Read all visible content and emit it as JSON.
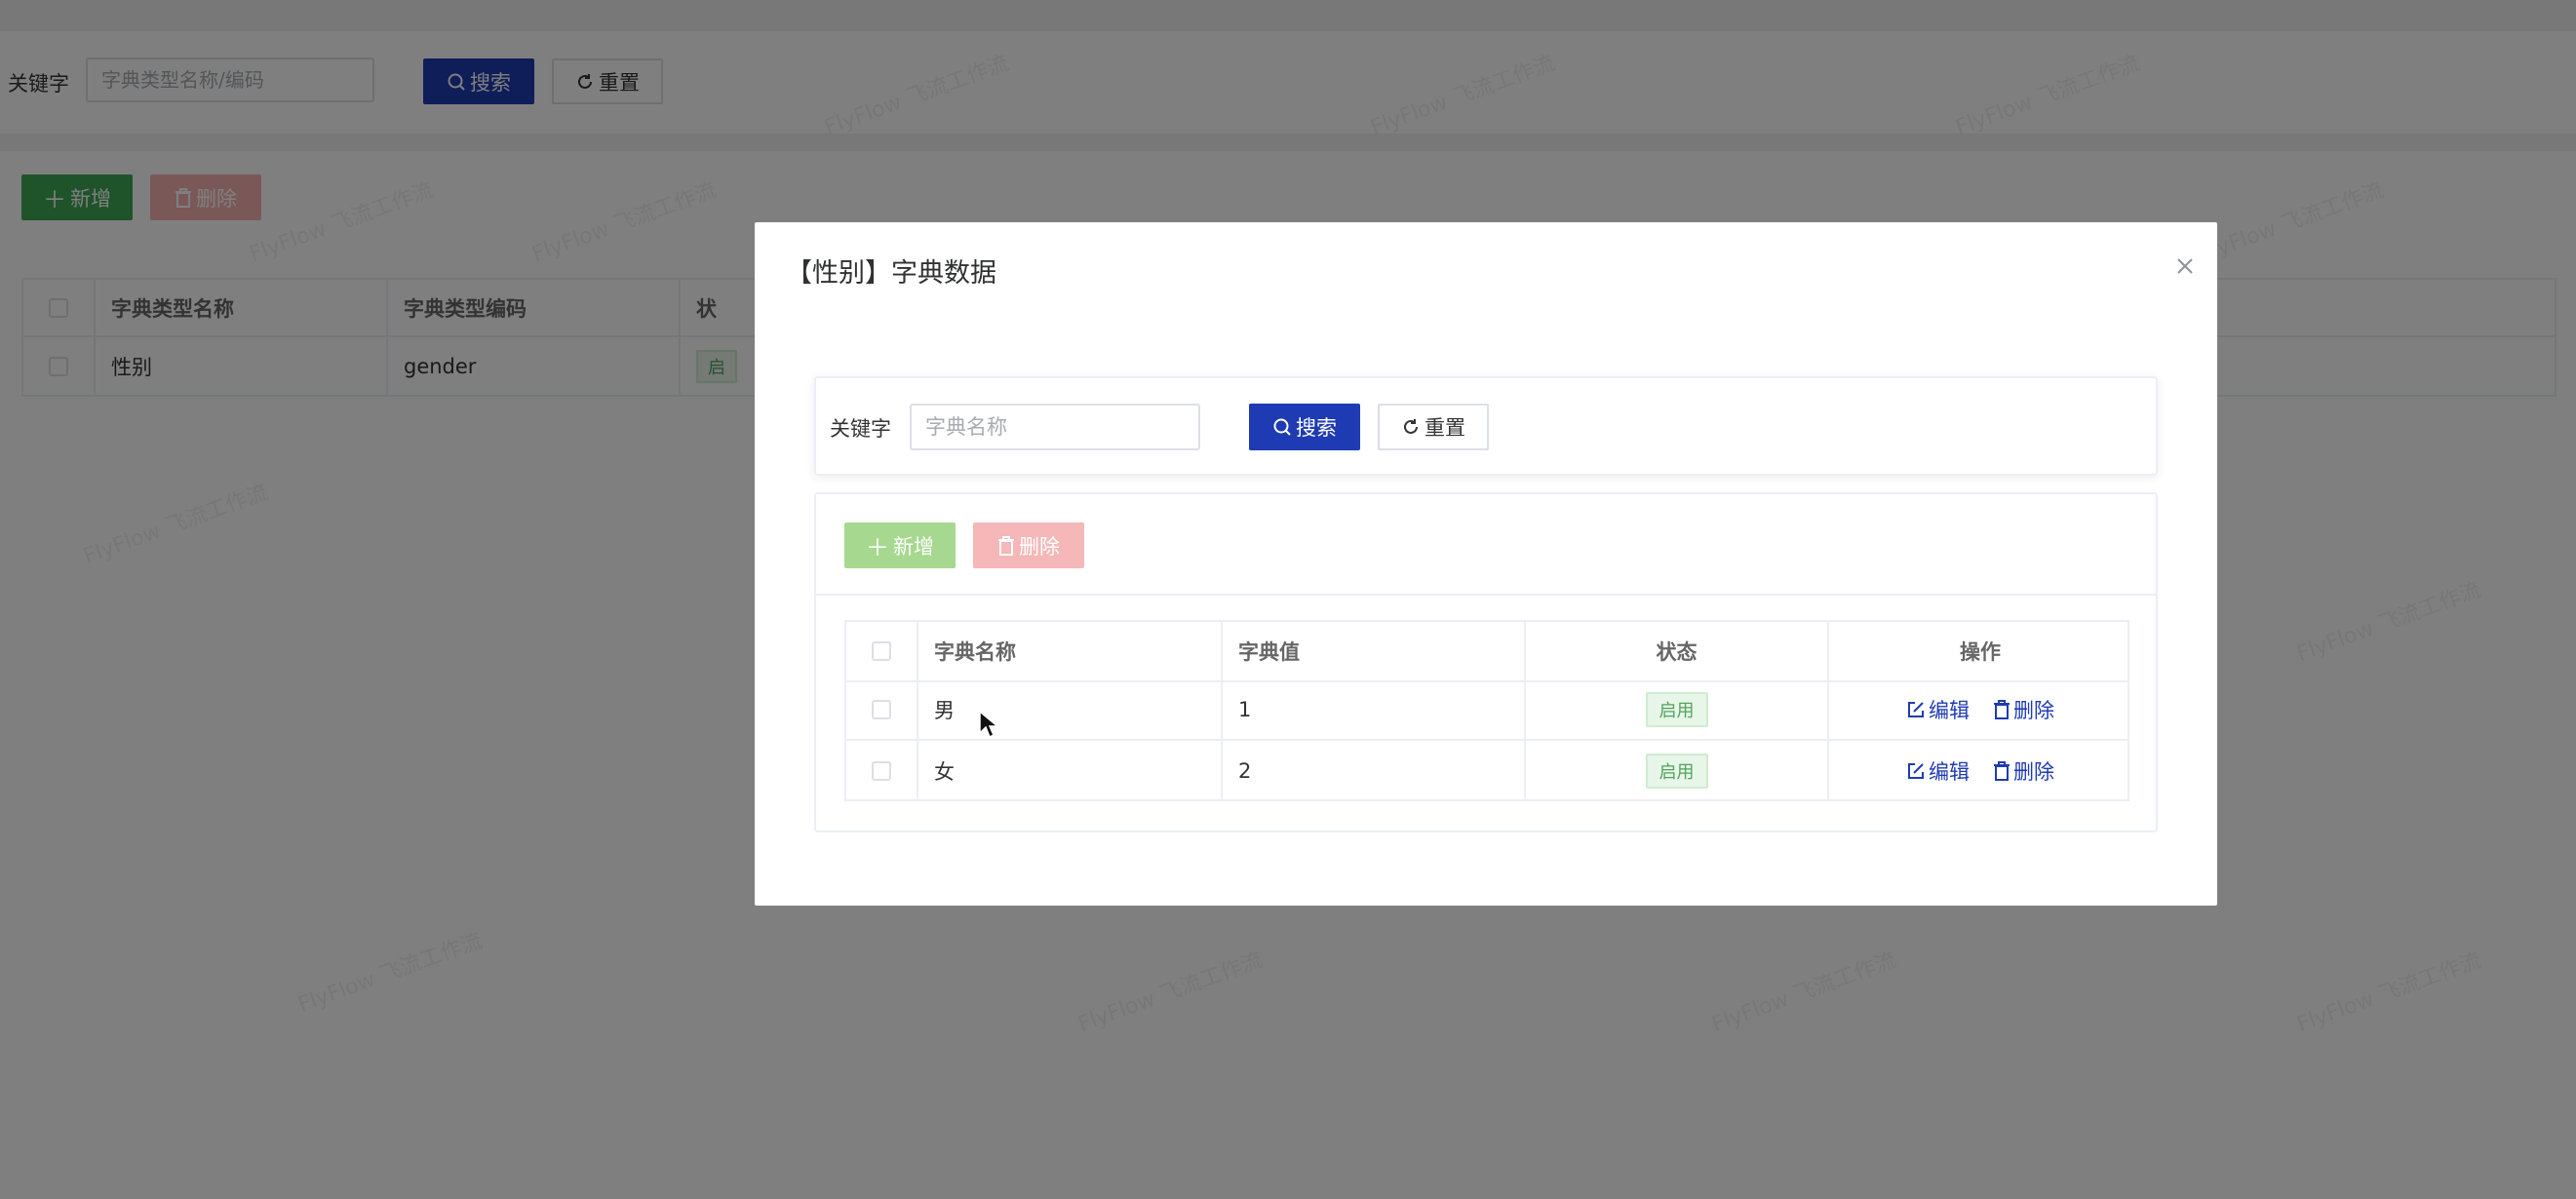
{
  "background": {
    "search": {
      "label": "关键字",
      "placeholder": "字典类型名称/编码",
      "search_label": "搜索",
      "reset_label": "重置"
    },
    "toolbar": {
      "add_label": "新增",
      "delete_label": "删除"
    },
    "table": {
      "headers": [
        "字典类型名称",
        "字典类型编码",
        "状"
      ],
      "rows": [
        {
          "name": "性别",
          "code": "gender",
          "status": "启"
        }
      ]
    },
    "watermark": "FlyFlow 飞流工作流"
  },
  "dialog": {
    "title": "【性别】字典数据",
    "close_icon": "close-icon",
    "search": {
      "label": "关键字",
      "placeholder": "字典名称",
      "search_label": "搜索",
      "reset_label": "重置"
    },
    "toolbar": {
      "add_label": "新增",
      "delete_label": "删除"
    },
    "table": {
      "headers": {
        "name": "字典名称",
        "value": "字典值",
        "status": "状态",
        "ops": "操作"
      },
      "rows": [
        {
          "name": "男",
          "value": "1",
          "status": "启用",
          "edit": "编辑",
          "delete": "删除"
        },
        {
          "name": "女",
          "value": "2",
          "status": "启用",
          "edit": "编辑",
          "delete": "删除"
        }
      ]
    }
  },
  "colors": {
    "primary": "#1f3bb3",
    "success": "#3fa654",
    "danger": "#f56c6c",
    "tag_text": "#52a35b"
  }
}
